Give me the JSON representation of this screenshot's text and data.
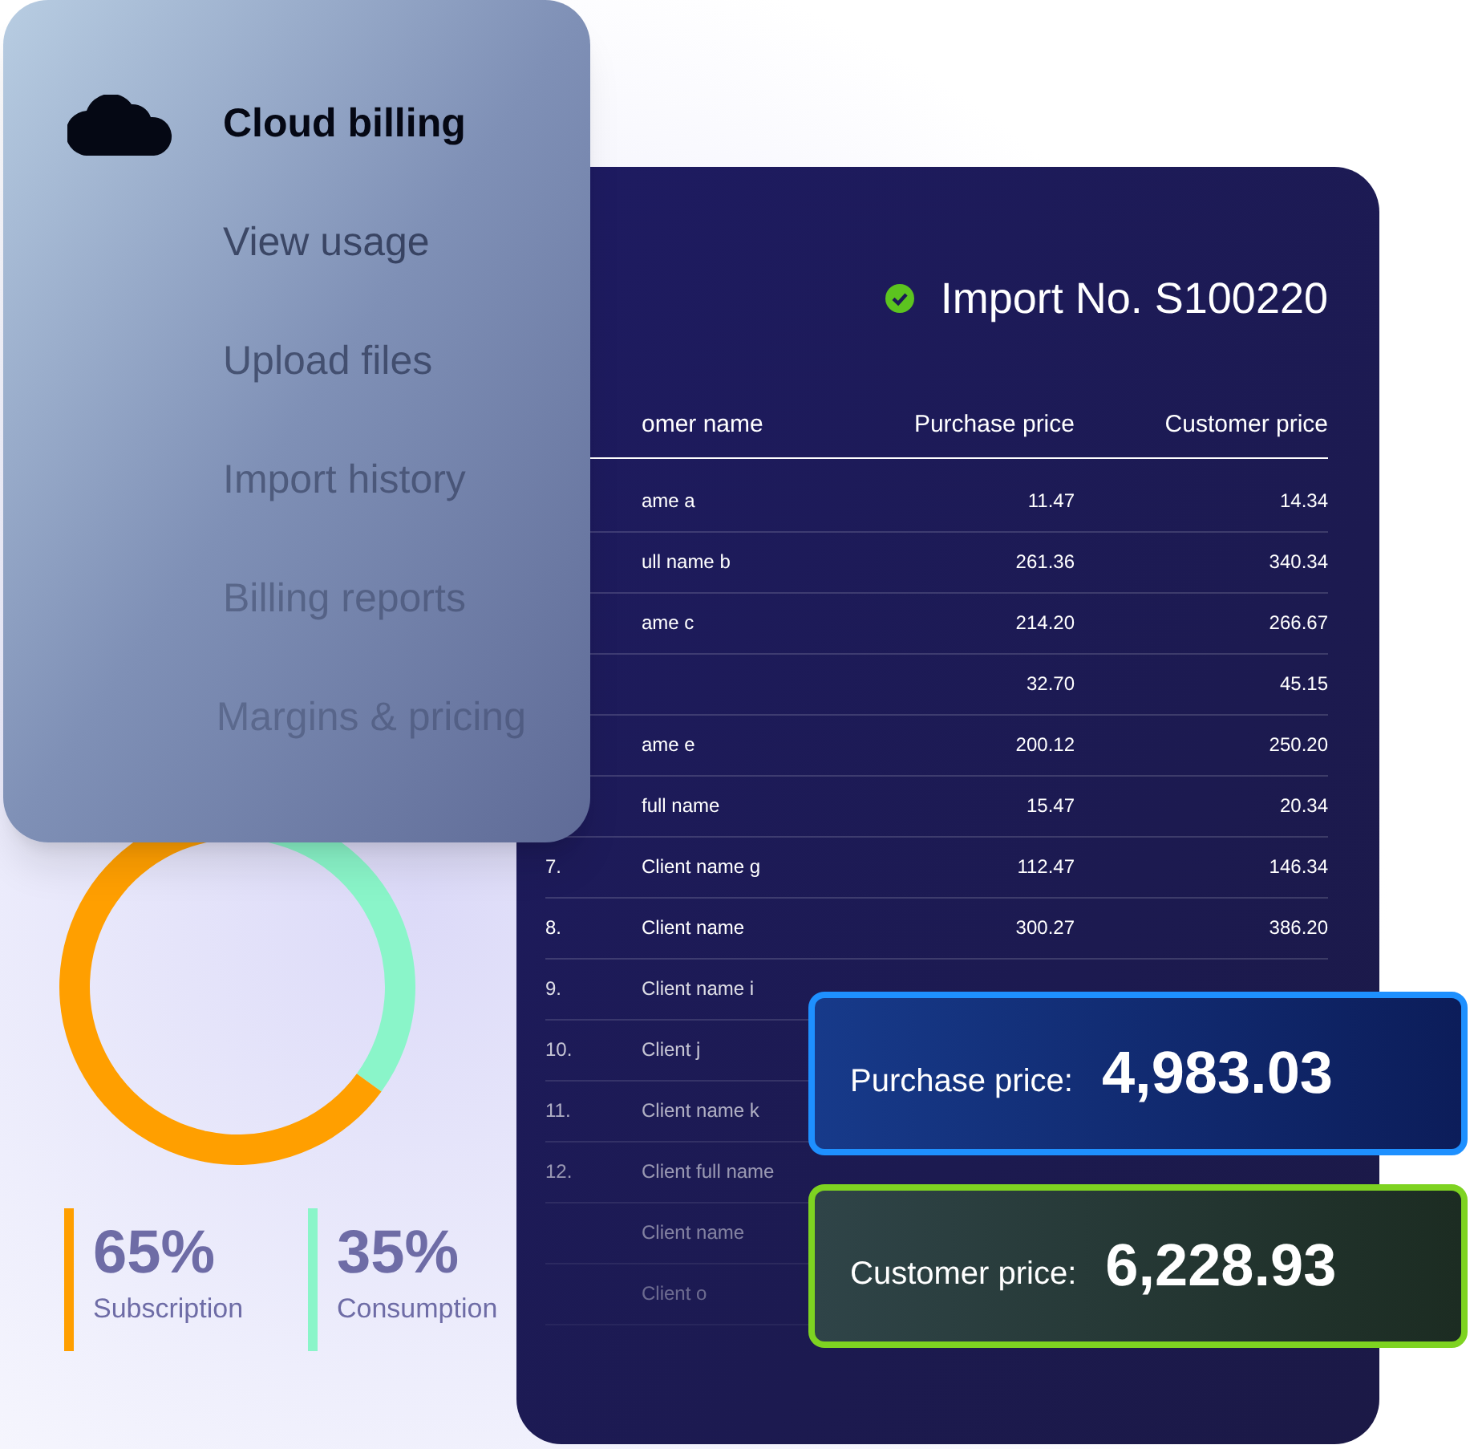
{
  "menu": {
    "items": [
      {
        "label": "Cloud billing",
        "selected": true
      },
      {
        "label": "View usage",
        "selected": false
      },
      {
        "label": "Upload files",
        "selected": false
      },
      {
        "label": "Import history",
        "selected": false
      },
      {
        "label": "Billing reports",
        "selected": false
      },
      {
        "label": "Margins & pricing",
        "selected": false
      }
    ]
  },
  "import": {
    "title": "Import No. S100220",
    "columns": [
      "omer name",
      "Purchase price",
      "Customer price"
    ],
    "rows": [
      {
        "name": "ame a",
        "purchase": "11.47",
        "customer": "14.34"
      },
      {
        "name": "ull name b",
        "purchase": "261.36",
        "customer": "340.34"
      },
      {
        "name": "ame c",
        "purchase": "214.20",
        "customer": "266.67"
      },
      {
        "purchase": "32.70",
        "customer": "45.15"
      },
      {
        "name": "ame e",
        "purchase": "200.12",
        "customer": "250.20"
      },
      {
        "name": "full name",
        "purchase": "15.47",
        "customer": "20.34"
      },
      {
        "no": "7.",
        "name": "Client name g",
        "purchase": "112.47",
        "customer": "146.34"
      },
      {
        "no": "8.",
        "name": "Client name",
        "purchase": "300.27",
        "customer": "386.20"
      },
      {
        "no": "9.",
        "name": "Client name i"
      },
      {
        "no": "10.",
        "name": "Client j"
      },
      {
        "no": "11.",
        "name": "Client name k"
      },
      {
        "no": "12.",
        "name": "Client full name"
      },
      {
        "name": "Client name"
      },
      {
        "name": "Client o"
      }
    ]
  },
  "totals": [
    {
      "kind": "purchase",
      "label": "Purchase price:",
      "value": "4,983.03"
    },
    {
      "kind": "customer",
      "label": "Customer price:",
      "value": "6,228.93"
    }
  ],
  "usage": {
    "chart_data": {
      "type": "donut",
      "categories": [
        "Subscription",
        "Consumption"
      ],
      "values": [
        65,
        35
      ]
    },
    "legend": [
      {
        "value": "65%",
        "color": "#ff9f00"
      },
      {
        "value": "35%",
        "color": "#8af5c9"
      }
    ]
  }
}
